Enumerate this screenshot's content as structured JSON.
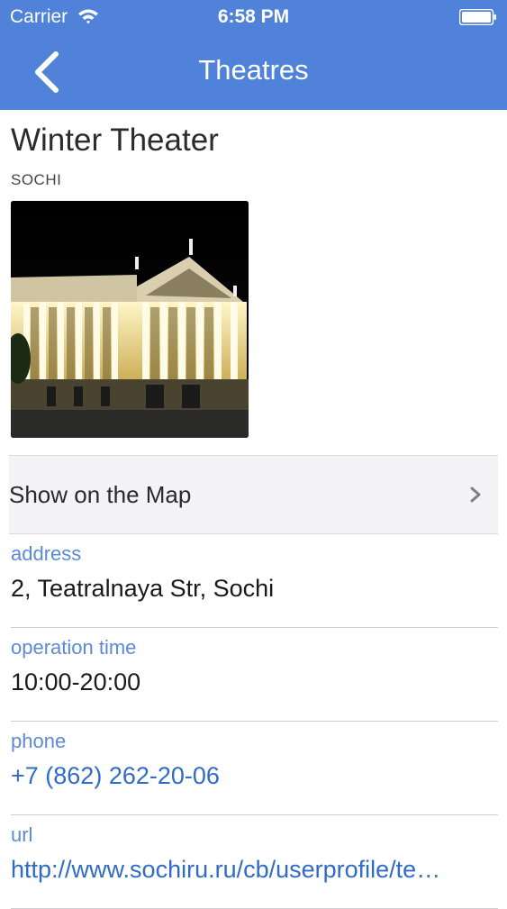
{
  "status_bar": {
    "carrier": "Carrier",
    "time": "6:58 PM"
  },
  "nav": {
    "title": "Theatres",
    "back_icon": "chevron-left-icon"
  },
  "theater": {
    "name": "Winter Theater",
    "city": "SOCHI"
  },
  "map_row": {
    "label": "Show on the Map",
    "icon": "chevron-right-icon"
  },
  "fields": [
    {
      "label": "address",
      "value": "2, Teatralnaya Str, Sochi"
    },
    {
      "label": "operation time",
      "value": "10:00-20:00"
    },
    {
      "label": "phone",
      "value": "+7 (862) 262-20-06"
    },
    {
      "label": "url",
      "value": "http://www.sochiru.ru/cb/userprofile/te…"
    }
  ],
  "colors": {
    "nav_background": "#4f82d8",
    "field_label": "#5b8bd6",
    "link": "#2f6bc7"
  }
}
